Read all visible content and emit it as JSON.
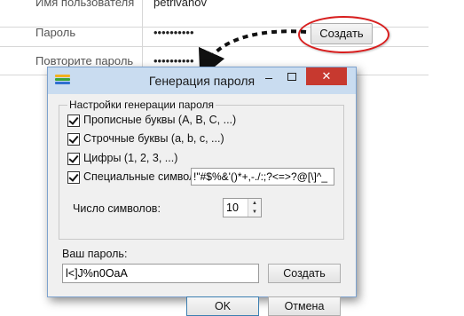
{
  "background_form": {
    "rows": [
      {
        "label": "Имя пользователя",
        "value": "petrivanov"
      },
      {
        "label": "Пароль",
        "value": "••••••••••"
      },
      {
        "label": "Повторите пароль",
        "value": "••••••••••"
      }
    ],
    "create_button": "Создать",
    "highlight_color": "#d81e1e"
  },
  "dialog": {
    "title": "Генерация пароля",
    "icon": "app-icon",
    "minimize_icon": "minimize-icon",
    "maximize_icon": "maximize-icon",
    "close_icon": "✕",
    "group_title": "Настройки генерации пароля",
    "options": [
      {
        "label": "Прописные буквы (A, B, C, ...)",
        "checked": true
      },
      {
        "label": "Строчные буквы (a, b, c, ...)",
        "checked": true
      },
      {
        "label": "Цифры (1, 2, 3, ...)",
        "checked": true
      },
      {
        "label": "Специальные символы",
        "checked": true
      }
    ],
    "special_chars_value": "!\"#$%&'()*+,-./:;?<=>?@[\\]^_",
    "length_label": "Число символов:",
    "length_value": "10",
    "password_label": "Ваш пароль:",
    "password_value": "l<]J%n0OaA",
    "create_button": "Создать",
    "ok_button": "OK",
    "cancel_button": "Отмена"
  },
  "colors": {
    "titlebar": "#c9dcf0",
    "close_button": "#c7392f",
    "dialog_bg": "#f0f0f0"
  }
}
